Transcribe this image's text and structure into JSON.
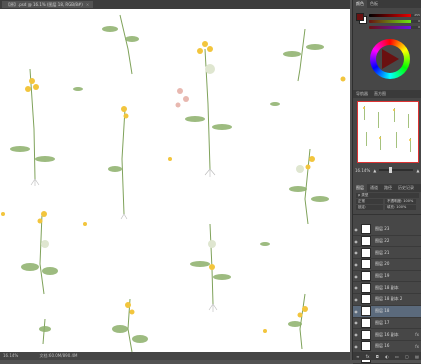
{
  "document_tab": {
    "title": "【原】.psd @ 16.1% (图层 18, RGB/8#)",
    "close_icon": "×"
  },
  "status_bar": {
    "zoom": "16.14%",
    "doc_info": "文档:60.0M/890.4M"
  },
  "color_panel": {
    "tabs": [
      "颜色",
      "色板"
    ],
    "foreground_color": "#6a1010",
    "background_color": "#ffffff",
    "slider_values": [
      "255",
      "0",
      "0"
    ]
  },
  "navigator_panel": {
    "tabs": [
      "导航器",
      "直方图"
    ],
    "zoom": "16.14%"
  },
  "layers_panel": {
    "tabs": [
      "图层",
      "通道",
      "路径",
      "历史记录"
    ],
    "filter_label": "ρ 类型",
    "blend_mode": "正常",
    "opacity": "不透明度: 100%",
    "lock": "锁定:",
    "fill": "填充: 100%",
    "layers": [
      {
        "name": "图层 23",
        "fx": false
      },
      {
        "name": "图层 22",
        "fx": false
      },
      {
        "name": "图层 21",
        "fx": false
      },
      {
        "name": "图层 20",
        "fx": false
      },
      {
        "name": "图层 19",
        "fx": false
      },
      {
        "name": "图层 18 副本",
        "fx": false
      },
      {
        "name": "图层 18 副本 2",
        "fx": false
      },
      {
        "name": "图层 18",
        "fx": false
      },
      {
        "name": "图层 17",
        "fx": false
      },
      {
        "name": "图层 16 副本",
        "fx": true
      },
      {
        "name": "图层 16",
        "fx": true
      },
      {
        "name": "图层 1 副本",
        "fx": false
      }
    ],
    "footer_icons": [
      "link-icon",
      "fx-icon",
      "mask-icon",
      "adjustment-icon",
      "folder-icon",
      "new-layer-icon",
      "trash-icon"
    ]
  }
}
